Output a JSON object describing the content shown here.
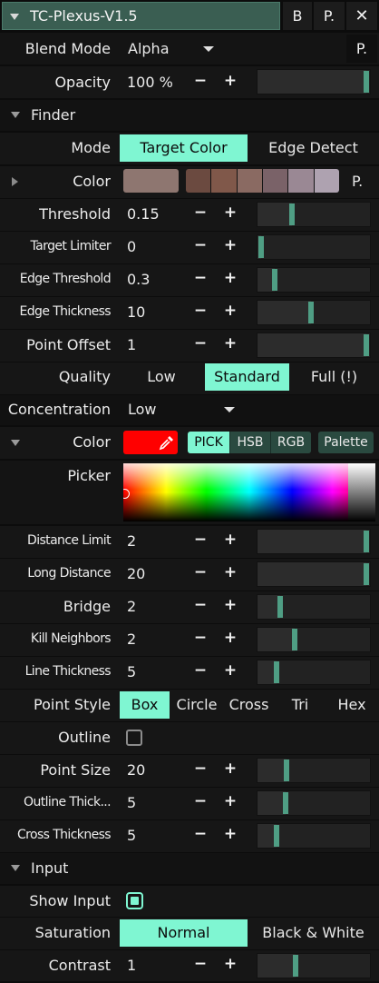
{
  "title": "TC-Plexus-V1.5",
  "title_buttons": [
    "B",
    "P.",
    "✕"
  ],
  "accent": "#7ff6d2",
  "blend": {
    "label": "Blend Mode",
    "value": "Alpha",
    "btn": "P."
  },
  "opacity": {
    "label": "Opacity",
    "value": "100 %",
    "level": 1.0
  },
  "finder": {
    "header": "Finder",
    "mode": {
      "label": "Mode",
      "options": [
        "Target Color",
        "Edge Detect"
      ],
      "selected": 0
    },
    "color": {
      "label": "Color",
      "main_swatch": "#8e7670",
      "swatches": [
        "#6b4a40",
        "#80584a",
        "#8a6a62",
        "#7a6268",
        "#9a8894",
        "#aea2b0"
      ],
      "btn": "P."
    },
    "threshold": {
      "label": "Threshold",
      "value": "0.15",
      "level": 0.29
    },
    "target_limiter": {
      "label": "Target Limiter",
      "value": "0",
      "level": 0.0
    },
    "edge_threshold": {
      "label": "Edge Threshold",
      "value": "0.3",
      "level": 0.13
    },
    "edge_thickness": {
      "label": "Edge Thickness",
      "value": "10",
      "level": 0.47
    },
    "point_offset": {
      "label": "Point Offset",
      "value": "1",
      "level": 1.0
    },
    "quality": {
      "label": "Quality",
      "options": [
        "Low",
        "Standard",
        "Full (!)"
      ],
      "selected": 1
    },
    "concentration": {
      "label": "Concentration",
      "value": "Low"
    }
  },
  "color_section": {
    "label": "Color",
    "swatch": "#ff0000",
    "eyedropper_icon": "eyedropper-icon",
    "modes": [
      "PICK",
      "HSB",
      "RGB"
    ],
    "selected_mode": 0,
    "palette": "Palette",
    "picker_label": "Picker"
  },
  "distance_limit": {
    "label": "Distance Limit",
    "value": "2",
    "level": 1.0
  },
  "long_distance": {
    "label": "Long Distance",
    "value": "20",
    "level": 1.0
  },
  "bridge": {
    "label": "Bridge",
    "value": "2",
    "level": 0.18
  },
  "kill_neighbors": {
    "label": "Kill Neighbors",
    "value": "2",
    "level": 0.32
  },
  "line_thickness": {
    "label": "Line Thickness",
    "value": "5",
    "level": 0.15
  },
  "point_style": {
    "label": "Point Style",
    "options": [
      "Box",
      "Circle",
      "Cross",
      "Tri",
      "Hex"
    ],
    "selected": 0
  },
  "outline": {
    "label": "Outline",
    "checked": false
  },
  "point_size": {
    "label": "Point Size",
    "value": "20",
    "level": 0.24
  },
  "outline_thickness": {
    "label": "Outline Thick...",
    "value": "5",
    "level": 0.23
  },
  "cross_thickness": {
    "label": "Cross Thickness",
    "value": "5",
    "level": 0.15
  },
  "input": {
    "header": "Input",
    "show_input": {
      "label": "Show Input",
      "checked": true
    },
    "saturation": {
      "label": "Saturation",
      "options": [
        "Normal",
        "Black & White"
      ],
      "selected": 0
    },
    "contrast": {
      "label": "Contrast",
      "value": "1",
      "level": 0.33
    }
  },
  "minus": "−",
  "plus": "+"
}
